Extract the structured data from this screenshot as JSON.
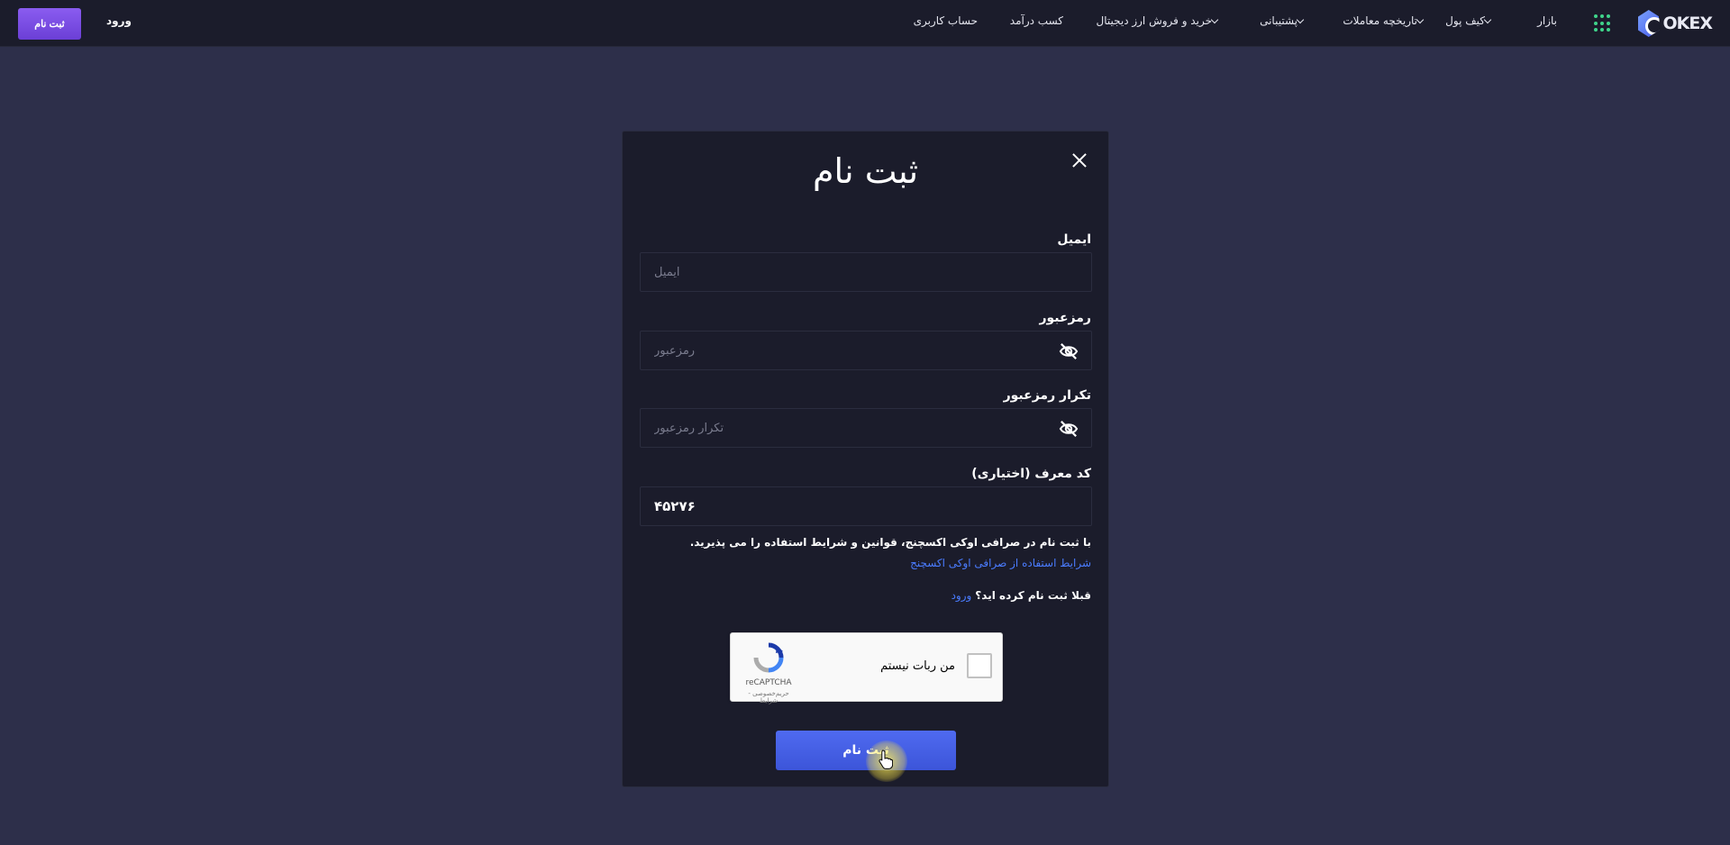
{
  "header": {
    "logo_text": "OKEX",
    "nav": [
      {
        "label": "بازار",
        "has_menu": false
      },
      {
        "label": "کیف پول",
        "has_menu": true
      },
      {
        "label": "تاریخچه معاملات",
        "has_menu": true
      },
      {
        "label": "پشتیبانی",
        "has_menu": true
      },
      {
        "label": "خرید و فروش ارز دیجیتال",
        "has_menu": true
      },
      {
        "label": "کسب درآمد",
        "has_menu": false
      },
      {
        "label": "حساب کاربری",
        "has_menu": false
      }
    ],
    "login_label": "ورود",
    "signup_label": "ثبت نام"
  },
  "modal": {
    "title": "ثبت نام",
    "email": {
      "label": "ایمیل",
      "placeholder": "ایمیل",
      "value": ""
    },
    "password": {
      "label": "رمزعبور",
      "placeholder": "رمزعبور",
      "value": ""
    },
    "password_repeat": {
      "label": "تکرار رمزعبور",
      "placeholder": "تکرار رمزعبور",
      "value": ""
    },
    "referral": {
      "label": "کد معرف (اختیاری)",
      "placeholder": "",
      "value": "۴۵۲۷۶"
    },
    "terms_text": "با ثبت نام در صرافی اوکی اکسچنج، قوانین و شرایط استفاده را می پذیرید.",
    "terms_link": "شرایط استفاده از صرافی اوکی اکسچنج",
    "already_text": "قبلا ثبت نام کرده اید؟",
    "already_link": "ورود",
    "captcha": {
      "label": "من ربات نیستم",
      "brand": "reCAPTCHA",
      "terms": "حریم‌خصوصی - شرایط"
    },
    "submit_label": "ثبت نام"
  },
  "colors": {
    "page_bg": "#2d2f4a",
    "card_bg": "#1b1c2b",
    "accent_purple": "#7c4ee4",
    "accent_blue": "#4a6cf0",
    "link_blue": "#4a7cff",
    "apps_green": "#3fd48a"
  },
  "icons": [
    "close-icon",
    "eye-off-icon",
    "apps-grid-icon",
    "chevron-down-icon",
    "recaptcha-icon",
    "hand-cursor-icon"
  ]
}
